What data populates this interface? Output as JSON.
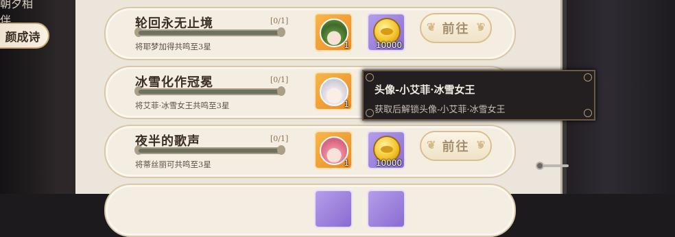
{
  "sidebar": {
    "top_label": "朝夕相伴",
    "active_tab": "颜成诗"
  },
  "quests": [
    {
      "title": "轮回永无止境",
      "progress": "[0/1]",
      "progress_fraction": 0,
      "description": "将耶梦加得共鸣至3星",
      "rewards": [
        {
          "type": "avatar",
          "icon": "avatar-green-hair-icon",
          "count": "1"
        },
        {
          "type": "coin",
          "icon": "gold-coin-icon",
          "count": "10000"
        }
      ],
      "button": "前往"
    },
    {
      "title": "冰雪化作冠冕",
      "progress": "[0/1]",
      "progress_fraction": 0,
      "description": "将艾菲·冰雪女王共鸣至3星",
      "rewards": [
        {
          "type": "avatar",
          "icon": "avatar-white-hair-icon",
          "count": "1"
        }
      ],
      "button": ""
    },
    {
      "title": "夜半的歌声",
      "progress": "[0/1]",
      "progress_fraction": 0,
      "description": "将蒂丝丽可共鸣至3星",
      "rewards": [
        {
          "type": "avatar",
          "icon": "avatar-pink-hair-icon",
          "count": "1"
        },
        {
          "type": "coin",
          "icon": "gold-coin-icon",
          "count": "10000"
        }
      ],
      "button": "前往"
    }
  ],
  "tooltip": {
    "title": "头像-小艾菲·冰雪女王",
    "description": "获取后解锁头像-小艾菲·冰雪女王"
  },
  "colors": {
    "reward_orange": "#f0a23a",
    "reward_purple": "#9f86de",
    "panel": "#ece5dc"
  }
}
